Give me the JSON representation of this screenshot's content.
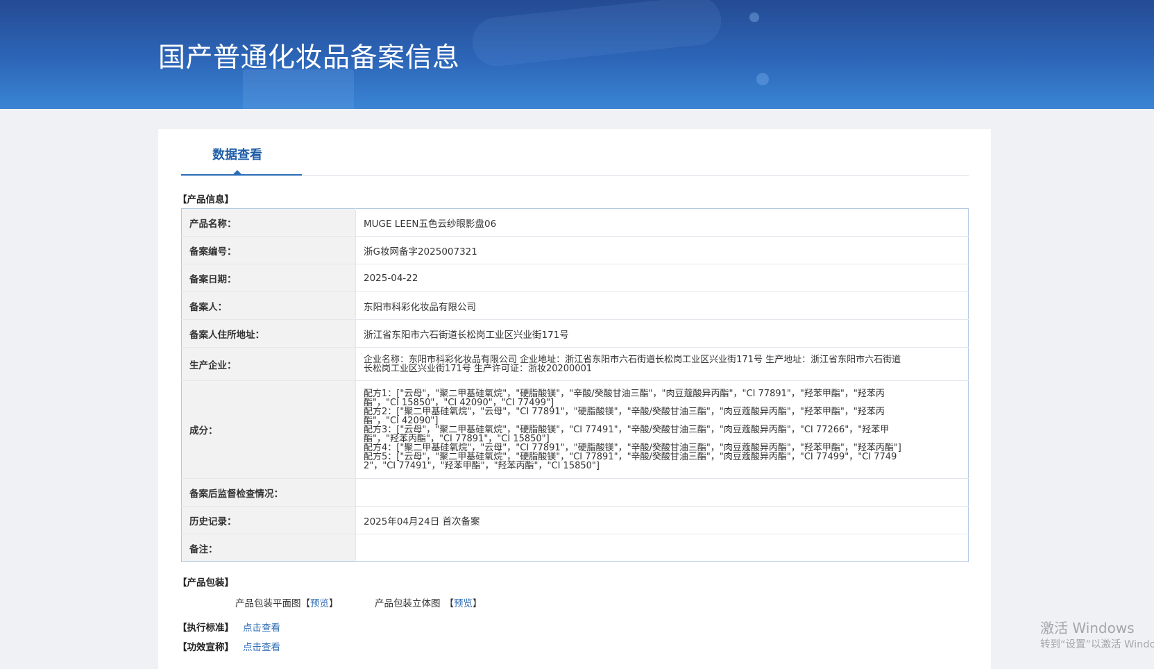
{
  "header": {
    "title": "国产普通化妆品备案信息"
  },
  "tab": {
    "label": "数据查看"
  },
  "product_info": {
    "section_title": "【产品信息】",
    "name": {
      "label": "产品名称：",
      "value": "MUGE LEEN五色云纱眼影盘06"
    },
    "filing_number": {
      "label": "备案编号：",
      "value": "浙G妆网备字2025007321"
    },
    "filing_date": {
      "label": "备案日期：",
      "value": "2025-04-22"
    },
    "filer": {
      "label": "备案人：",
      "value": "东阳市科彩化妆品有限公司"
    },
    "filer_address": {
      "label": "备案人住所地址：",
      "value": "浙江省东阳市六石街道长松岗工业区兴业街171号"
    },
    "manufacturer": {
      "label": "生产企业：",
      "value": "企业名称：东阳市科彩化妆品有限公司 企业地址：浙江省东阳市六石街道长松岗工业区兴业街171号 生产地址：浙江省东阳市六石街道长松岗工业区兴业街171号 生产许可证：浙妆20200001"
    },
    "ingredients": {
      "label": "成分：",
      "formulas": [
        "配方1：[\"云母\"，\"聚二甲基硅氧烷\"，\"硬脂酸镁\"，\"辛酸/癸酸甘油三酯\"，\"肉豆蔻酸异丙酯\"，\"CI 77891\"，\"羟苯甲酯\"，\"羟苯丙酯\"，\"CI 15850\"，\"CI 42090\"，\"CI 77499\"]",
        "配方2：[\"聚二甲基硅氧烷\"，\"云母\"，\"CI 77891\"，\"硬脂酸镁\"，\"辛酸/癸酸甘油三酯\"，\"肉豆蔻酸异丙酯\"，\"羟苯甲酯\"，\"羟苯丙酯\"，\"CI 42090\"]",
        "配方3：[\"云母\"，\"聚二甲基硅氧烷\"，\"硬脂酸镁\"，\"CI 77491\"，\"辛酸/癸酸甘油三酯\"，\"肉豆蔻酸异丙酯\"，\"CI 77266\"，\"羟苯甲酯\"，\"羟苯丙酯\"，\"CI 77891\"，\"CI 15850\"]",
        "配方4：[\"聚二甲基硅氧烷\"，\"云母\"，\"CI 77891\"，\"硬脂酸镁\"，\"辛酸/癸酸甘油三酯\"，\"肉豆蔻酸异丙酯\"，\"羟苯甲酯\"，\"羟苯丙酯\"]",
        "配方5：[\"云母\"，\"聚二甲基硅氧烷\"，\"硬脂酸镁\"，\"CI 77891\"，\"辛酸/癸酸甘油三酯\"，\"肉豆蔻酸异丙酯\"，\"CI 77499\"，\"CI 77492\"，\"CI 77491\"，\"羟苯甲酯\"，\"羟苯丙酯\"，\"CI 15850\"]"
      ]
    },
    "post_filing_inspection": {
      "label": "备案后监督检查情况："
    },
    "history": {
      "label": "历史记录：",
      "value": "2025年04月24日 首次备案"
    },
    "remarks": {
      "label": "备注："
    }
  },
  "packaging": {
    "section_title": "【产品包装】",
    "flat_image": {
      "label": "产品包装平面图",
      "bracket_open": "【",
      "link": "预览",
      "bracket_close": "】"
    },
    "stereo_image": {
      "label": "产品包装立体图",
      "bracket_open": "【",
      "link": "预览",
      "bracket_close": "】"
    }
  },
  "standard": {
    "section_title": "【执行标准】",
    "link": "点击查看"
  },
  "efficacy": {
    "section_title": "【功效宣称】",
    "link": "点击查看"
  },
  "watermark": {
    "line1": "激活 Windows",
    "line2": "转到“设置”以激活 Windo"
  },
  "colors": {
    "header_top": "#244b93",
    "header_bottom": "#3a85d4",
    "accent": "#1f5da8",
    "link": "#2f6db5",
    "label_background": "#f2f2f2",
    "page_background": "#eff1f4"
  }
}
